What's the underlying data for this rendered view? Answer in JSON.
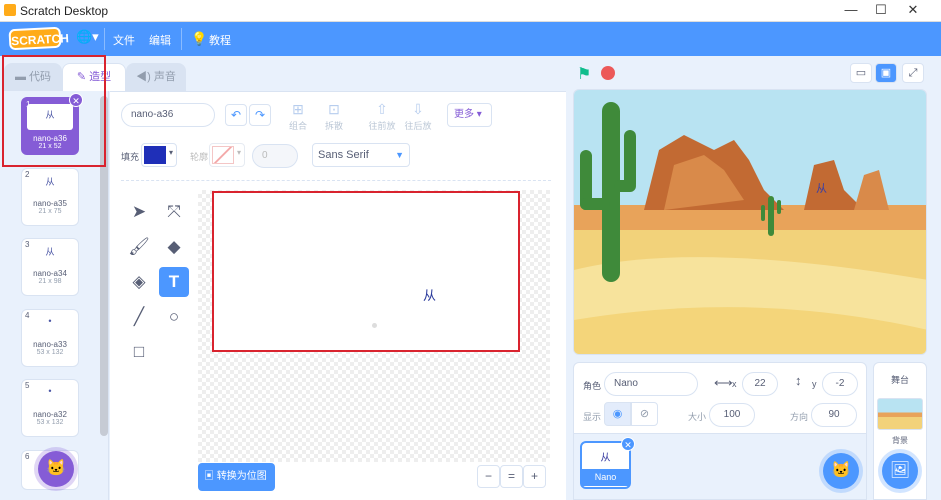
{
  "window": {
    "title": "Scratch Desktop",
    "minimize": "—",
    "maximize": "☐",
    "close": "✕"
  },
  "menu": {
    "logo": "SCRATCH",
    "globe": "🌐▾",
    "file": "文件",
    "edit": "编辑",
    "tutorials": "教程"
  },
  "tabs": {
    "code": "代码",
    "costumes": "造型",
    "sounds": "声音"
  },
  "costumes": [
    {
      "num": "1",
      "thumb": "从",
      "name": "nano-a36",
      "size": "21 x 52",
      "selected": true
    },
    {
      "num": "2",
      "thumb": "从",
      "name": "nano-a35",
      "size": "21 x 75"
    },
    {
      "num": "3",
      "thumb": "从",
      "name": "nano-a34",
      "size": "21 x 98"
    },
    {
      "num": "4",
      "thumb": "•",
      "name": "nano-a33",
      "size": "53 x 132"
    },
    {
      "num": "5",
      "thumb": "•",
      "name": "nano-a32",
      "size": "53 x 132"
    },
    {
      "num": "6",
      "thumb": "",
      "name": "",
      "size": ""
    }
  ],
  "editor": {
    "costume_name": "nano-a36",
    "group": "组合",
    "ungroup": "拆散",
    "forward": "往前放",
    "backward": "往后放",
    "more": "更多 ▾",
    "fill_label": "填充",
    "outline_label": "轮廓",
    "outline_width": "0",
    "font": "Sans Serif",
    "canvas_text": "从",
    "convert_bitmap": "转换为位图",
    "zoom_out": "−",
    "zoom_reset": "=",
    "zoom_in": "+"
  },
  "colors": {
    "fill": "#1f2fb8",
    "accent": "#855cd6",
    "blue": "#4c97ff",
    "highlight": "#d9232e"
  },
  "sprite": {
    "label_sprite": "角色",
    "name": "Nano",
    "label_x": "x",
    "x": "22",
    "label_y": "y",
    "y": "-2",
    "label_show": "显示",
    "label_size": "大小",
    "size": "100",
    "label_direction": "方向",
    "direction": "90",
    "tile_label": "Nano",
    "tile_thumb": "从"
  },
  "stage": {
    "label": "舞台",
    "backdrop_label": "背景",
    "sprite_glyph": "从"
  }
}
